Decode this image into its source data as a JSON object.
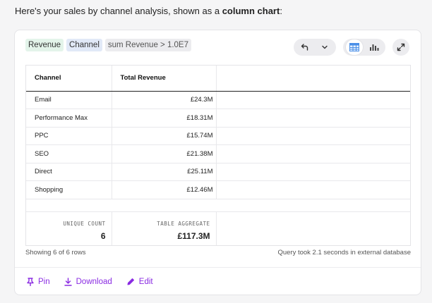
{
  "intro": {
    "prefix": "Here's your sales by channel analysis, shown as a ",
    "emphasis": "column chart",
    "suffix": ":"
  },
  "tags": [
    {
      "label": "Revenue"
    },
    {
      "label": "Channel"
    },
    {
      "label": "sum Revenue > 1.0E7"
    }
  ],
  "toolbar": {
    "icons": [
      "undo-icon",
      "chevron-down-icon",
      "table-view-icon",
      "chart-view-icon",
      "expand-icon"
    ],
    "active_view": "table"
  },
  "table": {
    "headers": [
      "Channel",
      "Total Revenue"
    ],
    "rows": [
      {
        "channel": "Email",
        "revenue": "£24.3M"
      },
      {
        "channel": "Performance Max",
        "revenue": "£18.31M"
      },
      {
        "channel": "PPC",
        "revenue": "£15.74M"
      },
      {
        "channel": "SEO",
        "revenue": "£21.38M"
      },
      {
        "channel": "Direct",
        "revenue": "£25.11M"
      },
      {
        "channel": "Shopping",
        "revenue": "£12.46M"
      }
    ],
    "aggregates": {
      "unique_count_label": "UNIQUE COUNT",
      "unique_count_value": "6",
      "table_aggregate_label": "TABLE AGGREGATE",
      "table_aggregate_value": "£117.3M"
    }
  },
  "footer": {
    "rows_shown": "Showing 6 of 6 rows",
    "query_time": "Query took 2.1 seconds in external database"
  },
  "actions": [
    {
      "label": "Pin",
      "icon": "pin-icon"
    },
    {
      "label": "Download",
      "icon": "download-icon"
    },
    {
      "label": "Edit",
      "icon": "edit-icon"
    }
  ],
  "colors": {
    "accent": "#8a2be2",
    "tag_revenue_bg": "#e3f4ea",
    "tag_channel_bg": "#e1e9f7",
    "table_view_icon": "#4a8fe7"
  }
}
